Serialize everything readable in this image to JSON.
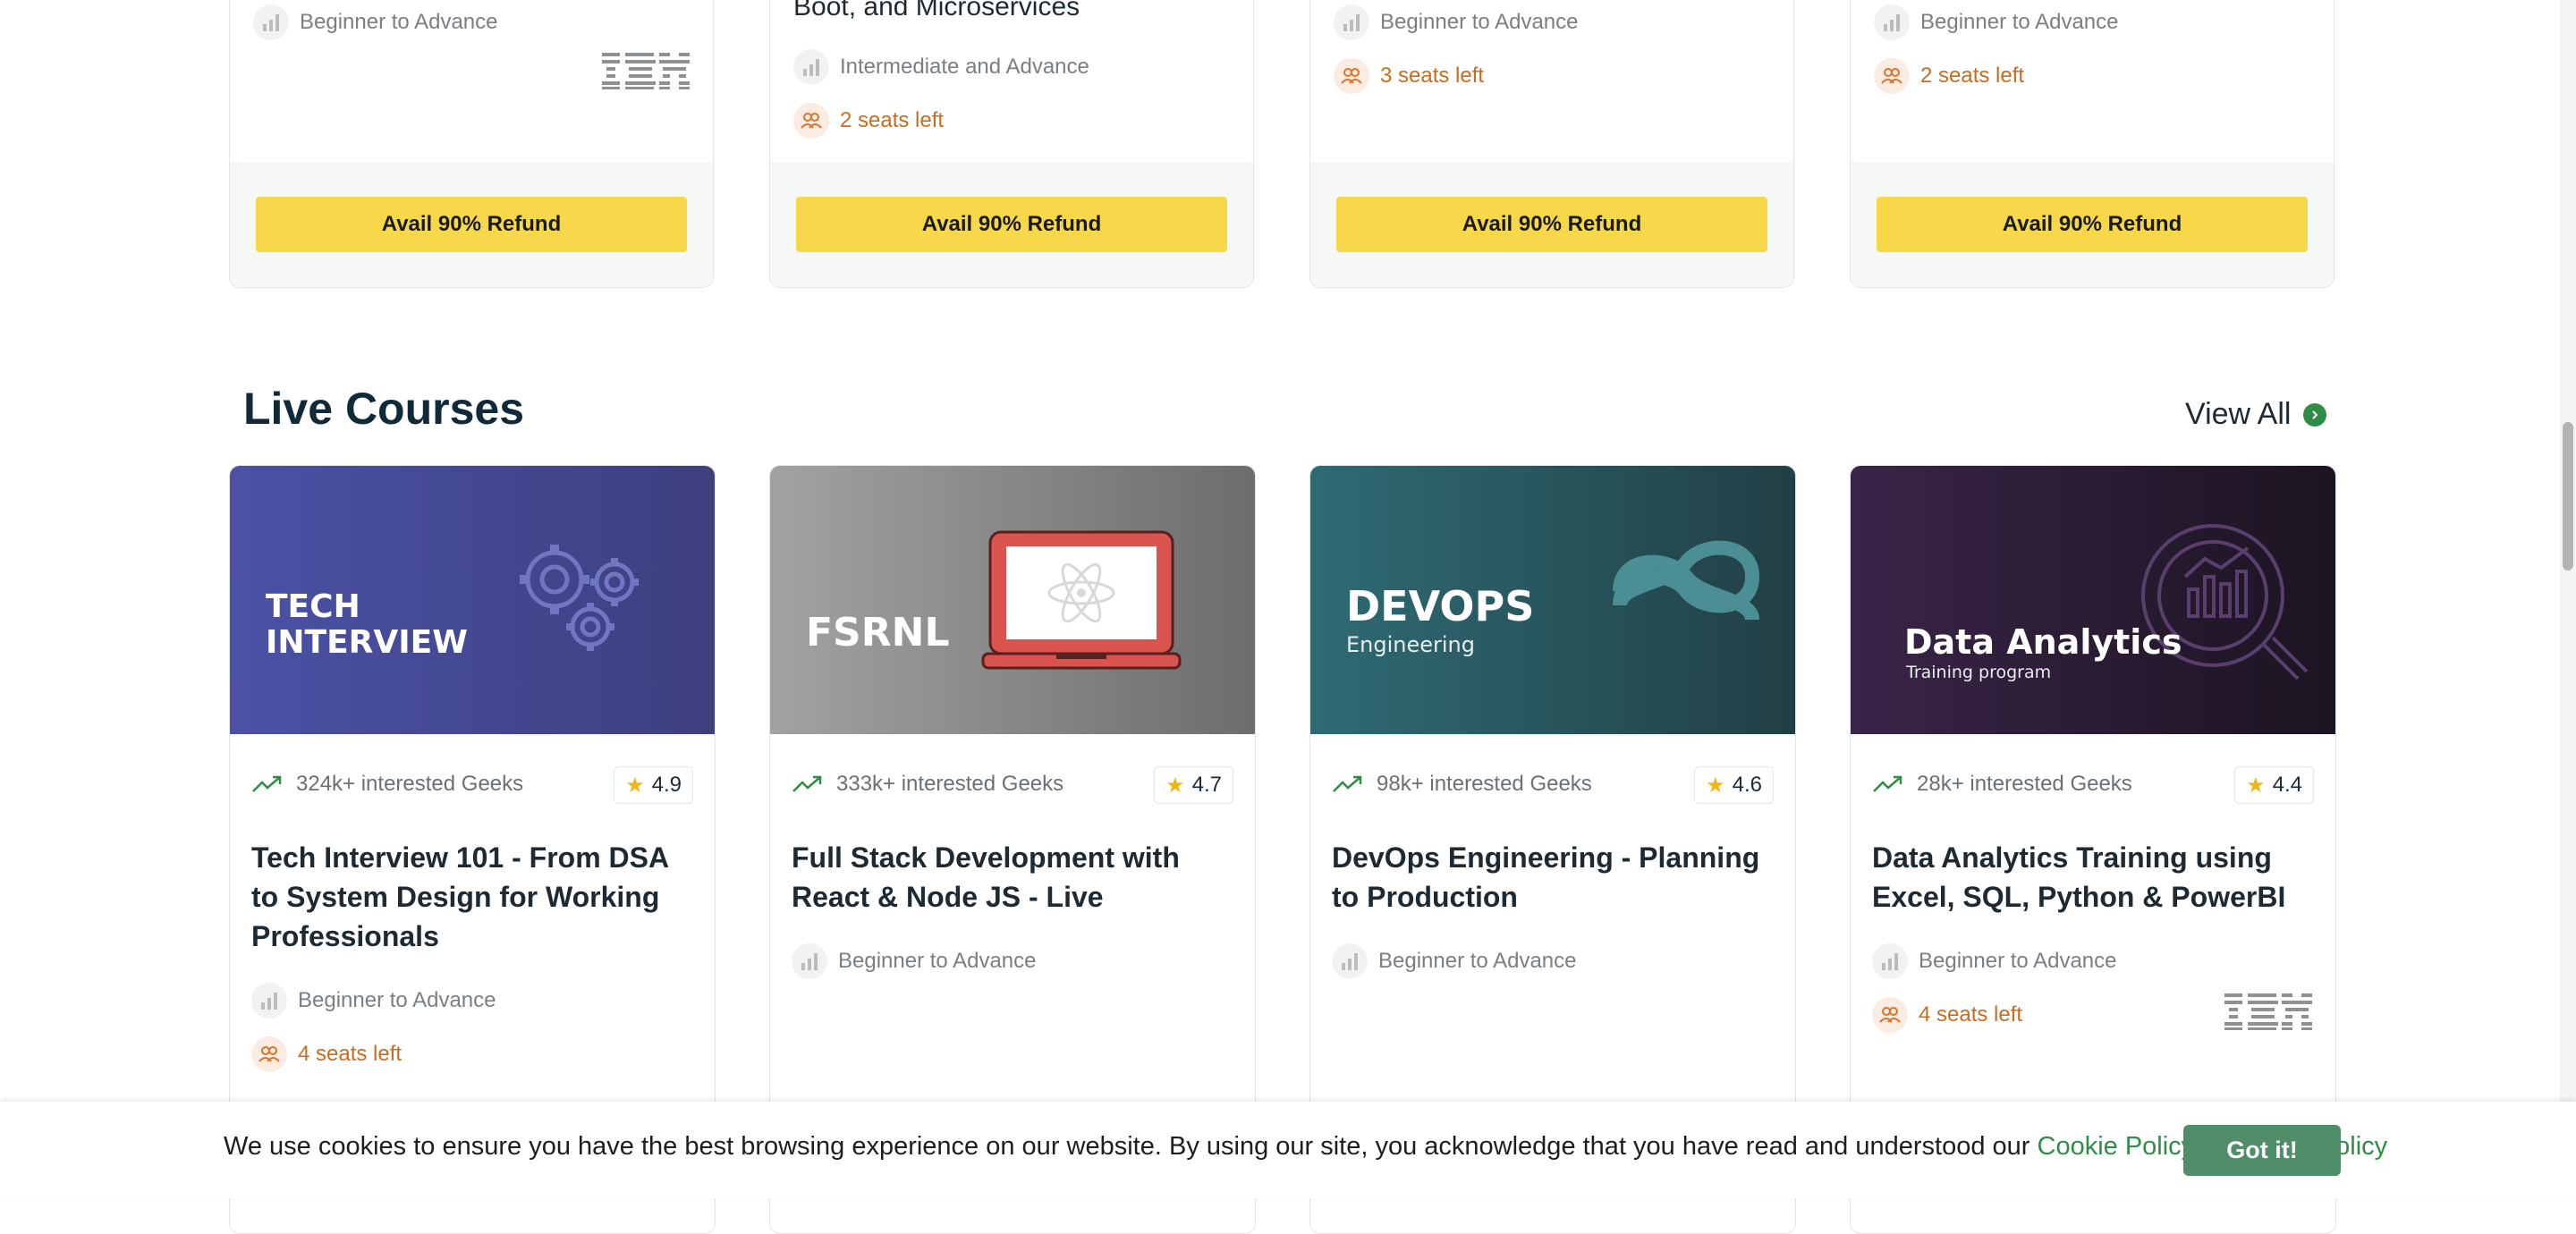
{
  "top_cards": [
    {
      "level": "Beginner to Advance",
      "seats": "",
      "logo": "IBM",
      "title_fragment": "",
      "button": "Avail 90% Refund"
    },
    {
      "level": "Intermediate and Advance",
      "seats": "2 seats left",
      "logo": "",
      "title_fragment": "Boot, and Microservices",
      "button": "Avail 90% Refund"
    },
    {
      "level": "Beginner to Advance",
      "seats": "3 seats left",
      "logo": "",
      "title_fragment": "",
      "button": "Avail 90% Refund"
    },
    {
      "level": "Beginner to Advance",
      "seats": "2 seats left",
      "logo": "",
      "title_fragment": "",
      "button": "Avail 90% Refund"
    }
  ],
  "section": {
    "title": "Live Courses",
    "view_all": "View All"
  },
  "courses": [
    {
      "banner_line1": "TECH",
      "banner_line2": "INTERVIEW",
      "banner_sub": "",
      "interested": "324k+ interested Geeks",
      "rating": "4.9",
      "title": "Tech Interview 101 - From DSA to System Design for Working Professionals",
      "level": "Beginner to Advance",
      "seats": "4 seats left",
      "logo": ""
    },
    {
      "banner_line1": "FSRNL",
      "banner_line2": "",
      "banner_sub": "",
      "interested": "333k+ interested Geeks",
      "rating": "4.7",
      "title": "Full Stack Development with React & Node JS - Live",
      "level": "Beginner to Advance",
      "seats": "",
      "logo": ""
    },
    {
      "banner_line1": "DEVOPS",
      "banner_line2": "",
      "banner_sub": "Engineering",
      "interested": "98k+ interested Geeks",
      "rating": "4.6",
      "title": "DevOps Engineering - Planning to Production",
      "level": "Beginner to Advance",
      "seats": "",
      "logo": ""
    },
    {
      "banner_line1": "Data Analytics",
      "banner_line2": "",
      "banner_sub": "Training program",
      "interested": "28k+ interested Geeks",
      "rating": "4.4",
      "title": "Data Analytics Training using Excel, SQL, Python & PowerBI",
      "level": "Beginner to Advance",
      "seats": "4 seats left",
      "logo": "IBM"
    }
  ],
  "cookie": {
    "text": "We use cookies to ensure you have the best browsing experience on our website. By using our site, you acknowledge that you have read and understood our",
    "cookie_policy": "Cookie Policy",
    "amp": "&",
    "privacy_policy": "Privacy Policy",
    "button": "Got it!"
  },
  "colors": {
    "accent_green": "#2f8d46",
    "button_yellow": "#f7d84a",
    "seats_orange": "#c96c22",
    "got_it_green": "#508d69"
  }
}
